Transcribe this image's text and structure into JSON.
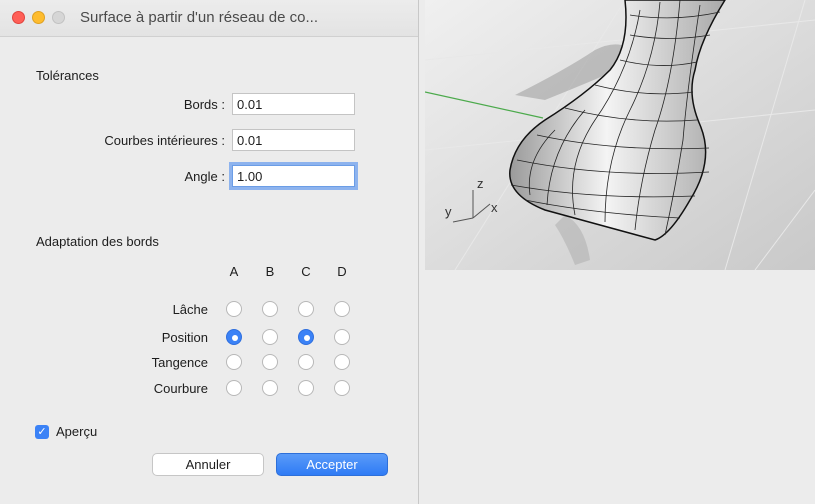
{
  "window": {
    "title": "Surface à partir d'un réseau de co..."
  },
  "tolerances": {
    "heading": "Tolérances",
    "fields": [
      {
        "label": "Bords :",
        "value": "0.01"
      },
      {
        "label": "Courbes intérieures :",
        "value": "0.01"
      },
      {
        "label": "Angle :",
        "value": "1.00"
      }
    ]
  },
  "edge_matching": {
    "heading": "Adaptation des bords",
    "columns": [
      "A",
      "B",
      "C",
      "D"
    ],
    "rows": [
      {
        "label": "Lâche",
        "selected": [
          false,
          false,
          false,
          false
        ]
      },
      {
        "label": "Position",
        "selected": [
          true,
          false,
          true,
          false
        ]
      },
      {
        "label": "Tangence",
        "selected": [
          false,
          false,
          false,
          false
        ]
      },
      {
        "label": "Courbure",
        "selected": [
          false,
          false,
          false,
          false
        ]
      }
    ]
  },
  "preview": {
    "label": "Aperçu",
    "checked": true
  },
  "buttons": {
    "cancel": "Annuler",
    "accept": "Accepter"
  },
  "viewport": {
    "axis_z": "z",
    "axis_y": "y",
    "axis_x": "x"
  },
  "colors": {
    "accent": "#3b82f6",
    "close": "#ff5f57",
    "minimize": "#febc2e"
  }
}
